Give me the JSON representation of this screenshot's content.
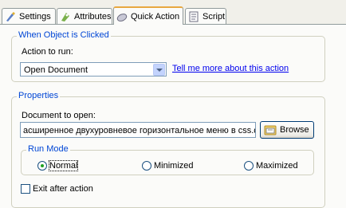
{
  "tabs": [
    {
      "label": "Settings",
      "icon": "settings-icon"
    },
    {
      "label": "Attributes",
      "icon": "attributes-icon"
    },
    {
      "label": "Quick Action",
      "icon": "quick-action-icon"
    },
    {
      "label": "Script",
      "icon": "script-icon"
    }
  ],
  "when_clicked": {
    "title": "When Object is Clicked",
    "action_label": "Action to run:",
    "action_value": "Open Document",
    "help_link": "Tell me more about this action"
  },
  "properties": {
    "title": "Properties",
    "document_label": "Document to open:",
    "document_value": "асширенное двухуровневое горизонтальное меню в css.docx",
    "browse_label": "Browse",
    "run_mode": {
      "title": "Run Mode",
      "options": [
        "Normal",
        "Minimized",
        "Maximized"
      ],
      "selected": "Normal"
    },
    "exit_after_label": "Exit after action",
    "exit_after_checked": false
  },
  "colors": {
    "group_title": "#0046d5",
    "active_tab_accent": "#e8a73f",
    "link": "#0000ee"
  }
}
